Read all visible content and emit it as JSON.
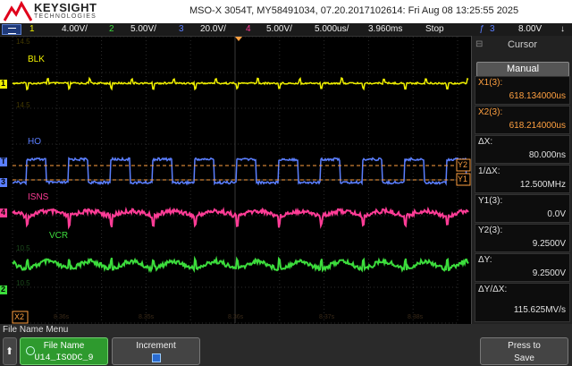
{
  "header": {
    "brand": "KEYSIGHT",
    "brand_sub": "TECHNOLOGIES",
    "instrument": "MSO-X 3054T, MY58491034, 07.20.2017102614: Fri Aug 08 13:25:55 2025"
  },
  "channel_bar": {
    "ch1_num": "1",
    "ch1_scale": "4.00V/",
    "ch2_num": "2",
    "ch2_scale": "5.00V/",
    "ch3_num": "3",
    "ch3_scale": "20.0V/",
    "ch4_num": "4",
    "ch4_scale": "5.00V/",
    "timebase": "5.000us/",
    "delay": "3.960ms",
    "run_state": "Stop",
    "trig_source": "3",
    "trig_level": "8.00V",
    "colors": {
      "ch1": "#f0f000",
      "ch2": "#3cdc3c",
      "ch3": "#5b7fff",
      "ch4": "#ff3c96"
    }
  },
  "plot": {
    "trace_labels": {
      "ch1": "BLK",
      "ch3": "HO",
      "ch4": "ISNS",
      "ch2": "VCR"
    },
    "faint_readouts": [
      "14.5",
      "14.5",
      "10.5",
      "10.5"
    ],
    "cursor_labels": {
      "x1": "X1",
      "x2": "X2",
      "y1": "Y1",
      "y2": "Y2"
    },
    "marker_labels": {
      "ch1": "1",
      "ch2": "2",
      "ch3": "3",
      "ch4": "4",
      "trig": "T"
    },
    "x_ticks": [
      "8.36s",
      "8.35s",
      "8.36s",
      "8.37s",
      "8.38s"
    ]
  },
  "cursor_panel": {
    "title": "Cursor",
    "mode": "Manual",
    "items": [
      {
        "label": "X1(3):",
        "value": "618.134000us",
        "color": "#ffa040"
      },
      {
        "label": "X2(3):",
        "value": "618.214000us",
        "color": "#ffa040"
      },
      {
        "label": "ΔX:",
        "value": "80.000ns",
        "color": "#e0e0e0"
      },
      {
        "label": "1/ΔX:",
        "value": "12.500MHz",
        "color": "#e0e0e0"
      },
      {
        "label": "Y1(3):",
        "value": "0.0V",
        "color": "#e0e0e0"
      },
      {
        "label": "Y2(3):",
        "value": "9.2500V",
        "color": "#e0e0e0"
      },
      {
        "label": "ΔY:",
        "value": "9.2500V",
        "color": "#e0e0e0"
      },
      {
        "label": "ΔY/ΔX:",
        "value": "115.625MV/s",
        "color": "#e0e0e0"
      }
    ]
  },
  "softkeys": {
    "menu_title": "File Name Menu",
    "back_icon": "up-arrow-icon",
    "file_name_label": "File Name",
    "file_name_value": "U14_ISODC_9",
    "increment_label": "Increment",
    "save_label_1": "Press to",
    "save_label_2": "Save"
  }
}
